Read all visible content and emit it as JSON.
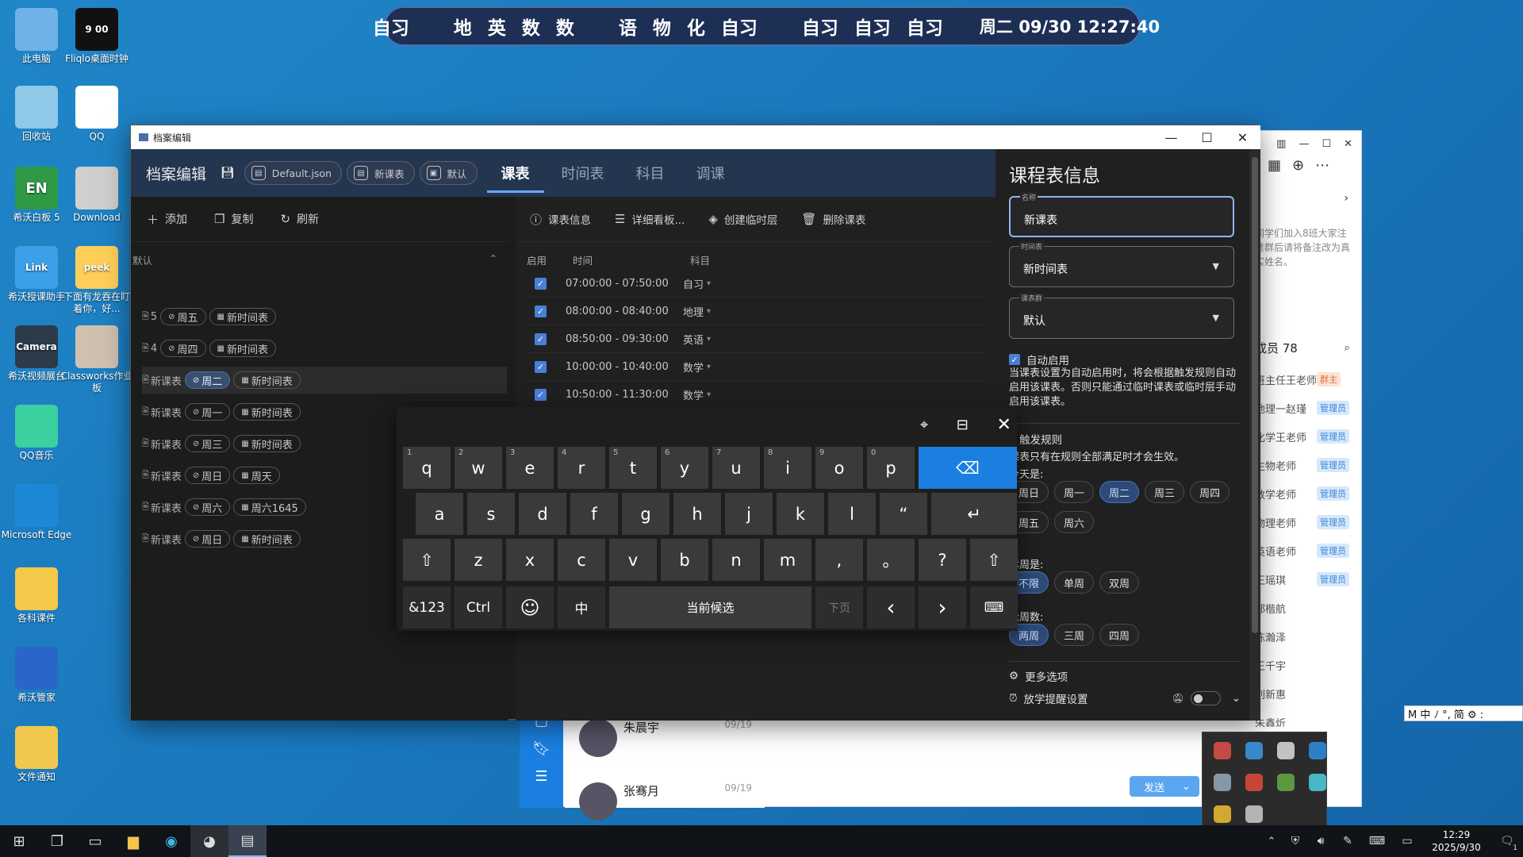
{
  "desktop_icons": [
    {
      "label": "此电脑",
      "icon": "computer-icon"
    },
    {
      "label": "Fliqlo桌面时钟",
      "icon": "clock-icon",
      "glyph": "9 00"
    },
    {
      "label": "回收站",
      "icon": "recycle-bin-icon"
    },
    {
      "label": "QQ",
      "icon": "qq-penguin-icon"
    },
    {
      "label": "希沃白板 5",
      "icon": "whiteboard-icon",
      "glyph": "EN"
    },
    {
      "label": "Download",
      "icon": "folder-image-icon"
    },
    {
      "label": "希沃授课助手",
      "icon": "link-icon",
      "glyph": "Link"
    },
    {
      "label": "下面有龙吞在盯着你，好...",
      "icon": "dragon-peek-icon",
      "glyph": "peek"
    },
    {
      "label": "希沃视频展台",
      "icon": "camera-icon",
      "glyph": "Camera"
    },
    {
      "label": "Classworks作业板",
      "icon": "classworks-icon"
    },
    {
      "label": "QQ音乐",
      "icon": "qq-music-icon"
    },
    {
      "label": "Microsoft Edge",
      "icon": "edge-icon"
    },
    {
      "label": "各科课件",
      "icon": "folder-icon"
    },
    {
      "label": "希沃管家",
      "icon": "shield-icon"
    },
    {
      "label": "文件通知",
      "icon": "warning-folder-icon"
    }
  ],
  "schedule_bar": {
    "groups": [
      [
        "自习"
      ],
      [
        "地",
        "英",
        "数",
        "数"
      ],
      [
        "语",
        "物",
        "化",
        "自习"
      ],
      [
        "自习",
        "自习",
        "自习"
      ]
    ],
    "datetime": "周二 09/30  12:27:40"
  },
  "app": {
    "window_title": "档案编辑",
    "header_title": "档案编辑",
    "chips": [
      "Default.json",
      "新课表",
      "默认"
    ],
    "tabs": [
      "课表",
      "时间表",
      "科目",
      "调课"
    ],
    "active_tab": "课表",
    "left_toolbar": [
      "添加",
      "复制",
      "刷新"
    ],
    "group_label": "默认",
    "schedules": [
      {
        "name": "5",
        "day": "周五",
        "timetable": "新时间表"
      },
      {
        "name": "4",
        "day": "周四",
        "timetable": "新时间表"
      },
      {
        "name": "新课表",
        "day": "周二",
        "timetable": "新时间表",
        "selected": true
      },
      {
        "name": "新课表",
        "day": "周一",
        "timetable": "新时间表"
      },
      {
        "name": "新课表",
        "day": "周三",
        "timetable": "新时间表"
      },
      {
        "name": "新课表",
        "day": "周日",
        "timetable": "周天"
      },
      {
        "name": "新课表",
        "day": "周六",
        "timetable": "周六1645"
      },
      {
        "name": "新课表",
        "day": "周日",
        "timetable": "新时间表"
      }
    ],
    "mid_toolbar": [
      "课表信息",
      "详细看板...",
      "创建临时层",
      "删除课表"
    ],
    "table_headers": [
      "启用",
      "时间",
      "科目"
    ],
    "classes": [
      {
        "time": "07:00:00 - 07:50:00",
        "subject": "自习"
      },
      {
        "time": "08:00:00 - 08:40:00",
        "subject": "地理"
      },
      {
        "time": "08:50:00 - 09:30:00",
        "subject": "英语"
      },
      {
        "time": "10:00:00 - 10:40:00",
        "subject": "数学"
      },
      {
        "time": "10:50:00 - 11:30:00",
        "subject": "数学"
      }
    ]
  },
  "info_panel": {
    "title": "课程表信息",
    "name_label": "名称",
    "name_value": "新课表",
    "timetable_label": "时间表",
    "timetable_value": "新时间表",
    "group_label": "课表群",
    "group_value": "默认",
    "auto_enable_label": "自动启用",
    "auto_enable_desc": "当课表设置为自动启用时，将会根据触发规则自动启用该课表。否则只能通过临时课表或临时层手动启用该课表。",
    "trigger_title": "触发规则",
    "trigger_desc": "课表只有在规则全部满足时才会生效。",
    "today_label": "今天是:",
    "weekdays": [
      "周日",
      "周一",
      "周二",
      "周三",
      "周四",
      "周五",
      "周六"
    ],
    "active_weekday": "周二",
    "week_label": "本周是:",
    "week_options": [
      "不限",
      "单周",
      "双周"
    ],
    "active_week": "不限",
    "rotation_label": "轮周数:",
    "rotation_options": [
      "两周",
      "三周",
      "四周"
    ],
    "active_rotation": "两周",
    "more_options": "更多选项",
    "reminder": "放学提醒设置"
  },
  "keyboard": {
    "row1": [
      [
        "q",
        "1"
      ],
      [
        "w",
        "2"
      ],
      [
        "e",
        "3"
      ],
      [
        "r",
        "4"
      ],
      [
        "t",
        "5"
      ],
      [
        "y",
        "6"
      ],
      [
        "u",
        "7"
      ],
      [
        "i",
        "8"
      ],
      [
        "o",
        "9"
      ],
      [
        "p",
        "0"
      ]
    ],
    "row2": [
      "a",
      "s",
      "d",
      "f",
      "g",
      "h",
      "j",
      "k",
      "l",
      "“"
    ],
    "row3": [
      "z",
      "x",
      "c",
      "v",
      "b",
      "n",
      "m",
      ",",
      "。",
      "?"
    ],
    "row4": {
      "sym": "&123",
      "ctrl": "Ctrl",
      "lang": "中",
      "candidate": "当前候选",
      "next_page": "下页"
    }
  },
  "chat": {
    "header_count": "成员 78",
    "group_notice": "同学们加入8班大家注意群后请将备注改为真实姓名。",
    "members": [
      {
        "name": "班主任王老师",
        "badge": "群主"
      },
      {
        "name": "地理一赵瑾",
        "badge": "管理员"
      },
      {
        "name": "化学王老师",
        "badge": "管理员"
      },
      {
        "name": "生物老师",
        "badge": "管理员"
      },
      {
        "name": "数学老师",
        "badge": "管理员"
      },
      {
        "name": "物理老师",
        "badge": "管理员"
      },
      {
        "name": "英语老师",
        "badge": "管理员"
      },
      {
        "name": "王瑶琪",
        "badge": "管理员"
      },
      {
        "name": "郑楷航",
        "badge": ""
      },
      {
        "name": "陈瀚泽",
        "badge": ""
      },
      {
        "name": "王千宇",
        "badge": ""
      },
      {
        "name": "刘新惠",
        "badge": ""
      },
      {
        "name": "朱鑫炘",
        "badge": ""
      }
    ],
    "contacts": [
      {
        "name": "朱晨宇",
        "date": "09/19"
      },
      {
        "name": "张骞月",
        "date": "09/19"
      }
    ],
    "send_label": "发送"
  },
  "ime_bar": "M 中 ﾉ °, 简 ⚙ :",
  "clock": {
    "time": "12:29",
    "date": "2025/9/30"
  },
  "notification_count": "1"
}
